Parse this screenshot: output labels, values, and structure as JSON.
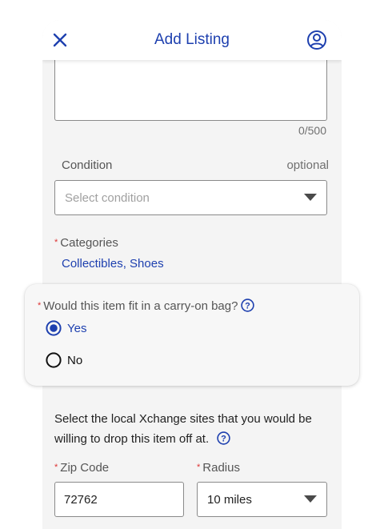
{
  "header": {
    "title": "Add Listing",
    "close_icon": "close-icon",
    "profile_icon": "user-circle-icon"
  },
  "description": {
    "char_count": "0/500"
  },
  "condition": {
    "label": "Condition",
    "optional_label": "optional",
    "placeholder": "Select condition"
  },
  "categories": {
    "required_mark": "*",
    "label": "Categories",
    "items": [
      "Collectibles",
      "Shoes"
    ],
    "separator": ","
  },
  "carry_on": {
    "required_mark": "*",
    "question": "Would this item fit in a carry-on bag?",
    "options": [
      {
        "label": "Yes",
        "selected": true
      },
      {
        "label": "No",
        "selected": false
      }
    ]
  },
  "xchange": {
    "text": "Select the local Xchange sites that you would be willing to drop this item off at."
  },
  "zip_code": {
    "required_mark": "*",
    "label": "Zip Code",
    "value": "72762"
  },
  "radius": {
    "required_mark": "*",
    "label": "Radius",
    "value": "10 miles"
  },
  "colors": {
    "accent": "#1e40af",
    "required": "#dd3333",
    "background": "#f4f4f4"
  }
}
